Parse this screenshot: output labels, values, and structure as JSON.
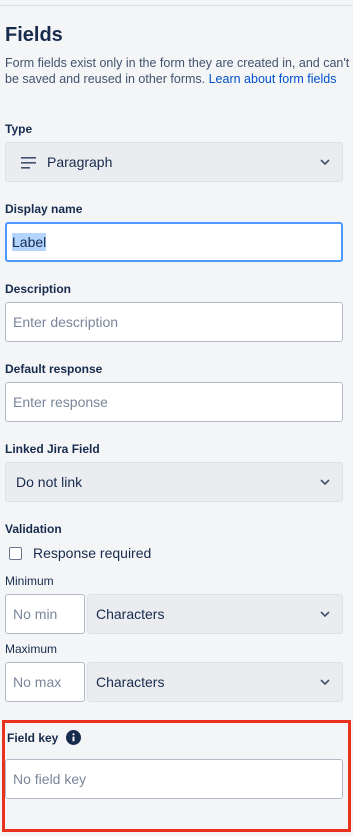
{
  "panel": {
    "title": "Fields",
    "intro_text": "Form fields exist only in the form they are created in, and can't be saved and reused in other forms.",
    "intro_link": "Learn about form fields"
  },
  "type": {
    "label": "Type",
    "value": "Paragraph",
    "icon": "paragraph-icon"
  },
  "display_name": {
    "label": "Display name",
    "value": "Label"
  },
  "description": {
    "label": "Description",
    "placeholder": "Enter description"
  },
  "default_response": {
    "label": "Default response",
    "placeholder": "Enter response"
  },
  "linked_jira_field": {
    "label": "Linked Jira Field",
    "value": "Do not link"
  },
  "validation": {
    "label": "Validation",
    "response_required_label": "Response required",
    "response_required_checked": false,
    "minimum": {
      "label": "Minimum",
      "placeholder": "No min",
      "unit": "Characters"
    },
    "maximum": {
      "label": "Maximum",
      "placeholder": "No max",
      "unit": "Characters"
    }
  },
  "field_key": {
    "label": "Field key",
    "placeholder": "No field key",
    "info_icon": "info-icon"
  },
  "colors": {
    "highlight": "#e8321f",
    "link": "#0052cc",
    "focus": "#4c9aff"
  }
}
